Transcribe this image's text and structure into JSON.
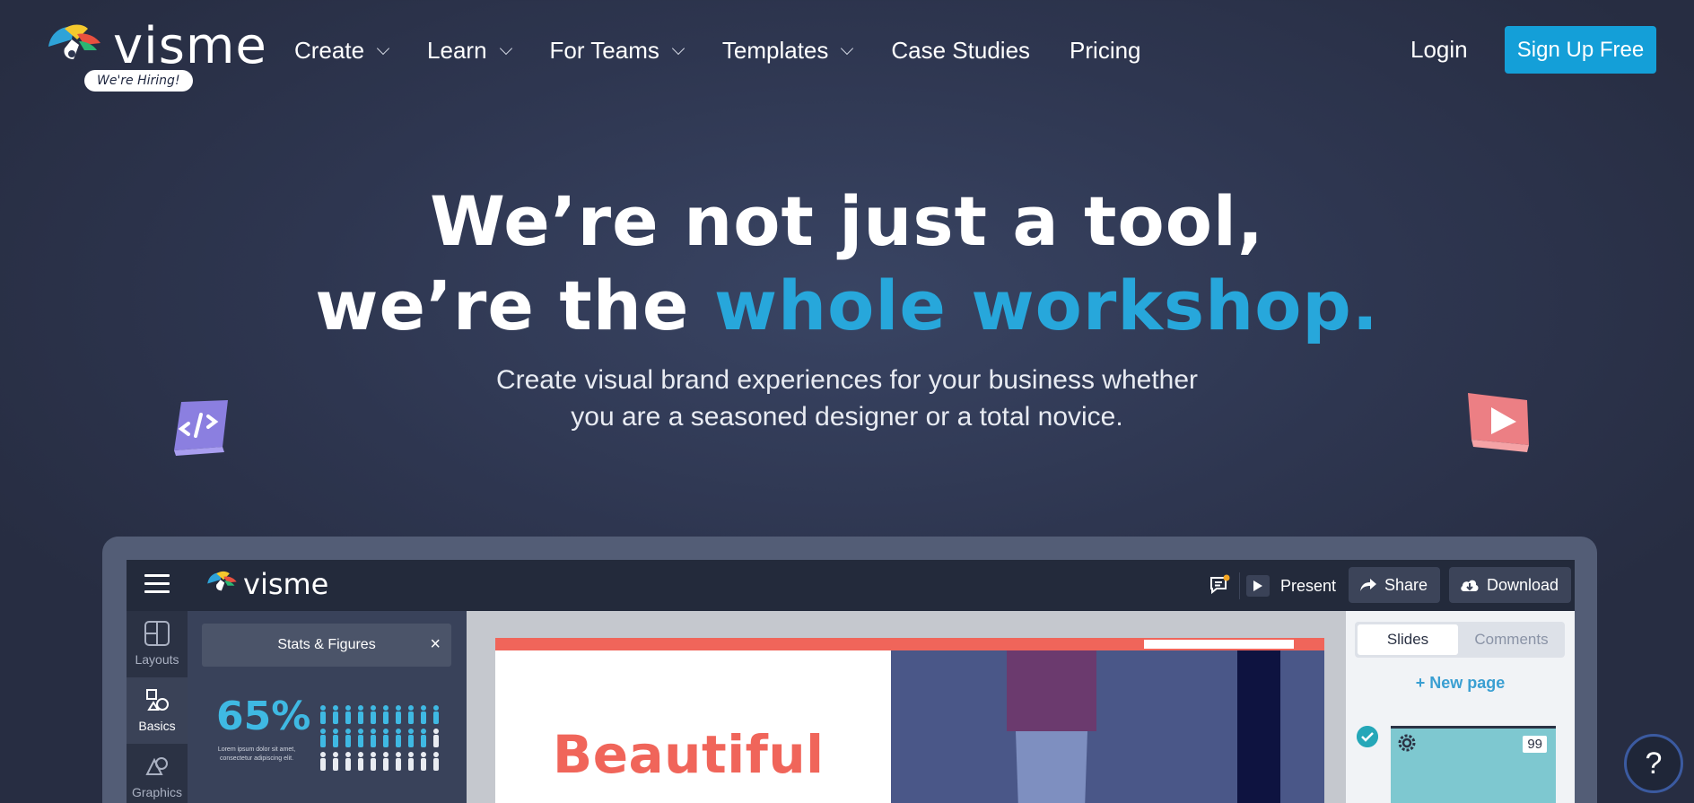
{
  "brand": {
    "name": "visme",
    "hiring_badge": "We're Hiring!"
  },
  "nav": {
    "items": [
      {
        "label": "Create",
        "has_dropdown": true
      },
      {
        "label": "Learn",
        "has_dropdown": true
      },
      {
        "label": "For Teams",
        "has_dropdown": true
      },
      {
        "label": "Templates",
        "has_dropdown": true
      },
      {
        "label": "Case Studies",
        "has_dropdown": false
      },
      {
        "label": "Pricing",
        "has_dropdown": false
      }
    ],
    "login": "Login",
    "signup": "Sign Up Free"
  },
  "hero": {
    "line1": "We’re not just a tool,",
    "line2_prefix": "we’re the ",
    "line2_accent": "whole workshop.",
    "sub_line1": "Create visual brand experiences for your business whether",
    "sub_line2": "you are a seasoned designer or a total novice."
  },
  "editor": {
    "logo": "visme",
    "present": "Present",
    "share": "Share",
    "download": "Download",
    "sidebar": [
      {
        "label": "Layouts",
        "icon": "layouts-icon"
      },
      {
        "label": "Basics",
        "icon": "basics-icon"
      },
      {
        "label": "Graphics",
        "icon": "graphics-icon"
      }
    ],
    "panel": {
      "title": "Stats & Figures",
      "close": "×",
      "stat_value": "65%",
      "stat_caption": "Lorem ipsum dolor sit amet, consectetur adipiscing elit."
    },
    "slide_heading": "Beautiful",
    "right_panel": {
      "tabs": [
        "Slides",
        "Comments"
      ],
      "new_page": "+ New page",
      "slide_number": "99"
    }
  },
  "help_button": "?",
  "colors": {
    "accent": "#27a7db",
    "signup": "#149fd8",
    "slide_red": "#f0655a"
  }
}
